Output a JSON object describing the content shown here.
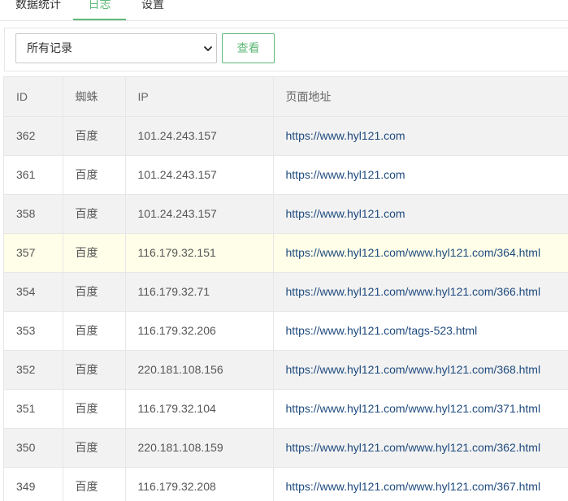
{
  "tabs": [
    {
      "label": "数据统计"
    },
    {
      "label": "日志"
    },
    {
      "label": "设置"
    }
  ],
  "filter": {
    "selected": "所有记录",
    "view_button": "查看"
  },
  "table": {
    "headers": [
      "ID",
      "蜘蛛",
      "IP",
      "页面地址"
    ],
    "rows": [
      {
        "id": "362",
        "spider": "百度",
        "ip": "101.24.243.157",
        "url": "https://www.hyl121.com"
      },
      {
        "id": "361",
        "spider": "百度",
        "ip": "101.24.243.157",
        "url": "https://www.hyl121.com"
      },
      {
        "id": "358",
        "spider": "百度",
        "ip": "101.24.243.157",
        "url": "https://www.hyl121.com"
      },
      {
        "id": "357",
        "spider": "百度",
        "ip": "116.179.32.151",
        "url": "https://www.hyl121.com/www.hyl121.com/364.html"
      },
      {
        "id": "354",
        "spider": "百度",
        "ip": "116.179.32.71",
        "url": "https://www.hyl121.com/www.hyl121.com/366.html"
      },
      {
        "id": "353",
        "spider": "百度",
        "ip": "116.179.32.206",
        "url": "https://www.hyl121.com/tags-523.html"
      },
      {
        "id": "352",
        "spider": "百度",
        "ip": "220.181.108.156",
        "url": "https://www.hyl121.com/www.hyl121.com/368.html"
      },
      {
        "id": "351",
        "spider": "百度",
        "ip": "116.179.32.104",
        "url": "https://www.hyl121.com/www.hyl121.com/371.html"
      },
      {
        "id": "350",
        "spider": "百度",
        "ip": "220.181.108.159",
        "url": "https://www.hyl121.com/www.hyl121.com/362.html"
      },
      {
        "id": "349",
        "spider": "百度",
        "ip": "116.179.32.208",
        "url": "https://www.hyl121.com/www.hyl121.com/367.html"
      }
    ]
  },
  "colors": {
    "accent": "#5fb878",
    "link": "#1e4a7e",
    "row_alt": "#f2f2f2",
    "row_highlight": "#ffffe9"
  },
  "icons": {
    "select_arrow": "chevron-down-icon"
  }
}
